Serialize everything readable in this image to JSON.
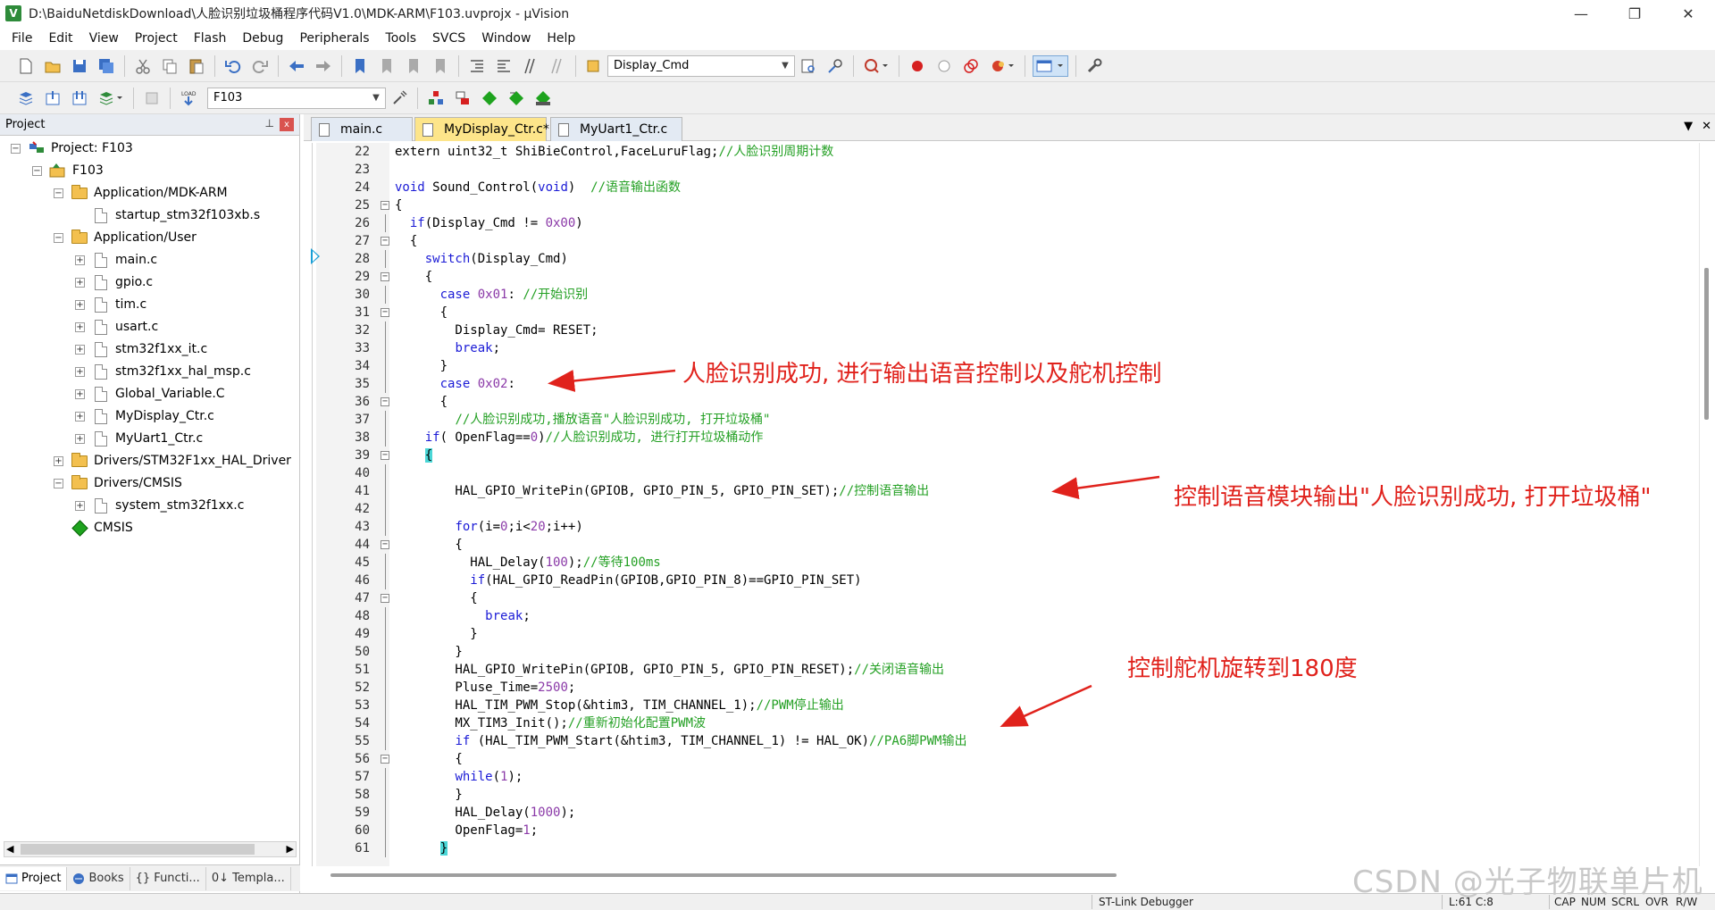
{
  "window": {
    "title": "D:\\BaiduNetdiskDownload\\人脸识别垃圾桶程序代码V1.0\\MDK-ARM\\F103.uvprojx - µVision",
    "logo": "V",
    "minimize": "—",
    "maximize": "❐",
    "close": "✕"
  },
  "menu": [
    "File",
    "Edit",
    "View",
    "Project",
    "Flash",
    "Debug",
    "Peripherals",
    "Tools",
    "SVCS",
    "Window",
    "Help"
  ],
  "toolbar1": {
    "find_combo": "Display_Cmd",
    "icons": [
      "new-file-icon",
      "open-file-icon",
      "save-icon",
      "save-all-icon",
      "cut-icon",
      "copy-icon",
      "paste-icon",
      "undo-icon",
      "redo-icon",
      "back-icon",
      "forward-icon",
      "bookmark-icon",
      "prev-bookmark-icon",
      "next-bookmark-icon",
      "clear-bookmark-icon",
      "indent-icon",
      "unindent-icon",
      "comment-icon",
      "uncomment-icon",
      "find-in-files-icon",
      "find-icon",
      "incremental-find-icon",
      "debug-session-icon",
      "breakpoint-icon",
      "disable-breakpoint-icon",
      "kill-breakpoints-icon",
      "run-to-cursor-icon",
      "window-layout-icon",
      "configure-icon"
    ]
  },
  "toolbar2": {
    "target_combo": "F103",
    "icons": [
      "translate-icon",
      "build-icon",
      "rebuild-icon",
      "batch-build-icon",
      "stop-build-icon",
      "load-icon",
      "target-options-icon",
      "manage-components-icon",
      "component-icon",
      "pack-installer-icon",
      "select-packs-icon"
    ],
    "load_label": "LOAD"
  },
  "project_panel": {
    "title": "Project",
    "pin": "📌",
    "close": "x",
    "tree": [
      {
        "level": 0,
        "expander": "−",
        "icon": "project",
        "label": "Project: F103"
      },
      {
        "level": 1,
        "expander": "−",
        "icon": "target",
        "label": "F103"
      },
      {
        "level": 2,
        "expander": "−",
        "icon": "folder",
        "label": "Application/MDK-ARM"
      },
      {
        "level": 3,
        "expander": "",
        "icon": "file",
        "label": "startup_stm32f103xb.s"
      },
      {
        "level": 2,
        "expander": "−",
        "icon": "folder",
        "label": "Application/User"
      },
      {
        "level": 3,
        "expander": "+",
        "icon": "file",
        "label": "main.c"
      },
      {
        "level": 3,
        "expander": "+",
        "icon": "file",
        "label": "gpio.c"
      },
      {
        "level": 3,
        "expander": "+",
        "icon": "file",
        "label": "tim.c"
      },
      {
        "level": 3,
        "expander": "+",
        "icon": "file",
        "label": "usart.c"
      },
      {
        "level": 3,
        "expander": "+",
        "icon": "file",
        "label": "stm32f1xx_it.c"
      },
      {
        "level": 3,
        "expander": "+",
        "icon": "file",
        "label": "stm32f1xx_hal_msp.c"
      },
      {
        "level": 3,
        "expander": "+",
        "icon": "file",
        "label": "Global_Variable.C"
      },
      {
        "level": 3,
        "expander": "+",
        "icon": "file",
        "label": "MyDisplay_Ctr.c"
      },
      {
        "level": 3,
        "expander": "+",
        "icon": "file",
        "label": "MyUart1_Ctr.c"
      },
      {
        "level": 2,
        "expander": "+",
        "icon": "folder",
        "label": "Drivers/STM32F1xx_HAL_Driver"
      },
      {
        "level": 2,
        "expander": "−",
        "icon": "folder",
        "label": "Drivers/CMSIS"
      },
      {
        "level": 3,
        "expander": "+",
        "icon": "file",
        "label": "system_stm32f1xx.c"
      },
      {
        "level": 2,
        "expander": "",
        "icon": "diamond",
        "label": "CMSIS"
      }
    ],
    "bottom_tabs": [
      {
        "label": "Project",
        "icon": "project-tab-icon"
      },
      {
        "label": "Books",
        "icon": "books-tab-icon"
      },
      {
        "label": "{} Functi...",
        "icon": "functions-tab-icon"
      },
      {
        "label": "0↓ Templa...",
        "icon": "templates-tab-icon"
      }
    ],
    "scroll_left": "◀",
    "scroll_right": "▶"
  },
  "editor": {
    "tabs": [
      {
        "label": "main.c",
        "active": false
      },
      {
        "label": "MyDisplay_Ctr.c*",
        "active": true
      },
      {
        "label": "MyUart1_Ctr.c",
        "active": false
      }
    ],
    "tab_controls": [
      "▼",
      "✕"
    ],
    "lines": [
      {
        "n": "22",
        "fold": "",
        "code": [
          [
            "",
            "extern uint32_t ShiBieControl,FaceLuruFlag;"
          ],
          [
            "cm",
            "//人脸识别周期计数"
          ]
        ]
      },
      {
        "n": "23",
        "fold": "",
        "code": []
      },
      {
        "n": "24",
        "fold": "",
        "code": [
          [
            "kw",
            "void"
          ],
          [
            "",
            " Sound_Control("
          ],
          [
            "kw",
            "void"
          ],
          [
            "",
            ")  "
          ],
          [
            "cm",
            "//语音输出函数"
          ]
        ]
      },
      {
        "n": "25",
        "fold": "box",
        "code": [
          [
            "",
            "{"
          ]
        ]
      },
      {
        "n": "26",
        "fold": "line",
        "code": [
          [
            "",
            "  "
          ],
          [
            "kw",
            "if"
          ],
          [
            "",
            "(Display_Cmd != "
          ],
          [
            "num",
            "0x00"
          ],
          [
            "",
            ")"
          ]
        ]
      },
      {
        "n": "27",
        "fold": "box",
        "code": [
          [
            "",
            "  {"
          ]
        ]
      },
      {
        "n": "28",
        "fold": "line",
        "code": [
          [
            "",
            "    "
          ],
          [
            "kw",
            "switch"
          ],
          [
            "",
            "(Display_Cmd)"
          ]
        ]
      },
      {
        "n": "29",
        "fold": "box",
        "code": [
          [
            "",
            "    {"
          ]
        ]
      },
      {
        "n": "30",
        "fold": "line",
        "code": [
          [
            "",
            "      "
          ],
          [
            "kw",
            "case"
          ],
          [
            "",
            " "
          ],
          [
            "num",
            "0x01"
          ],
          [
            "",
            ": "
          ],
          [
            "cm",
            "//开始识别"
          ]
        ]
      },
      {
        "n": "31",
        "fold": "box",
        "code": [
          [
            "",
            "      {"
          ]
        ]
      },
      {
        "n": "32",
        "fold": "line",
        "code": [
          [
            "",
            "        Display_Cmd= RESET;"
          ]
        ]
      },
      {
        "n": "33",
        "fold": "line",
        "code": [
          [
            "",
            "        "
          ],
          [
            "kw",
            "break"
          ],
          [
            "",
            ";"
          ]
        ]
      },
      {
        "n": "34",
        "fold": "line",
        "code": [
          [
            "",
            "      }"
          ]
        ]
      },
      {
        "n": "35",
        "fold": "line",
        "code": [
          [
            "",
            "      "
          ],
          [
            "kw",
            "case"
          ],
          [
            "",
            " "
          ],
          [
            "num",
            "0x02"
          ],
          [
            "",
            ":"
          ]
        ]
      },
      {
        "n": "36",
        "fold": "box",
        "code": [
          [
            "",
            "      {"
          ]
        ]
      },
      {
        "n": "37",
        "fold": "line",
        "code": [
          [
            "",
            "        "
          ],
          [
            "cm",
            "//人脸识别成功,播放语音\"人脸识别成功, 打开垃圾桶\""
          ]
        ]
      },
      {
        "n": "38",
        "fold": "line",
        "code": [
          [
            "",
            "    "
          ],
          [
            "kw",
            "if"
          ],
          [
            "",
            "( OpenFlag=="
          ],
          [
            "num",
            "0"
          ],
          [
            "",
            ")"
          ],
          [
            "cm",
            "//人脸识别成功, 进行打开垃圾桶动作"
          ]
        ]
      },
      {
        "n": "39",
        "fold": "box",
        "code": [
          [
            "",
            "    "
          ],
          [
            "brk",
            "{"
          ]
        ]
      },
      {
        "n": "40",
        "fold": "line",
        "code": []
      },
      {
        "n": "41",
        "fold": "line",
        "code": [
          [
            "",
            "        HAL_GPIO_WritePin(GPIOB, GPIO_PIN_5, GPIO_PIN_SET);"
          ],
          [
            "cm",
            "//控制语音输出"
          ]
        ]
      },
      {
        "n": "42",
        "fold": "line",
        "code": []
      },
      {
        "n": "43",
        "fold": "line",
        "code": [
          [
            "",
            "        "
          ],
          [
            "kw",
            "for"
          ],
          [
            "",
            "(i="
          ],
          [
            "num",
            "0"
          ],
          [
            "",
            ";i<"
          ],
          [
            "num",
            "20"
          ],
          [
            "",
            ";i++)"
          ]
        ]
      },
      {
        "n": "44",
        "fold": "box",
        "code": [
          [
            "",
            "        {"
          ]
        ]
      },
      {
        "n": "45",
        "fold": "line",
        "code": [
          [
            "",
            "          HAL_Delay("
          ],
          [
            "num",
            "100"
          ],
          [
            "",
            ");"
          ],
          [
            "cm",
            "//等待100ms"
          ]
        ]
      },
      {
        "n": "46",
        "fold": "line",
        "code": [
          [
            "",
            "          "
          ],
          [
            "kw",
            "if"
          ],
          [
            "",
            "(HAL_GPIO_ReadPin(GPIOB,GPIO_PIN_8)==GPIO_PIN_SET)"
          ]
        ]
      },
      {
        "n": "47",
        "fold": "box",
        "code": [
          [
            "",
            "          {"
          ]
        ]
      },
      {
        "n": "48",
        "fold": "line",
        "code": [
          [
            "",
            "            "
          ],
          [
            "kw",
            "break"
          ],
          [
            "",
            ";"
          ]
        ]
      },
      {
        "n": "49",
        "fold": "line",
        "code": [
          [
            "",
            "          }"
          ]
        ]
      },
      {
        "n": "50",
        "fold": "line",
        "code": [
          [
            "",
            "        }"
          ]
        ]
      },
      {
        "n": "51",
        "fold": "line",
        "code": [
          [
            "",
            "        HAL_GPIO_WritePin(GPIOB, GPIO_PIN_5, GPIO_PIN_RESET);"
          ],
          [
            "cm",
            "//关闭语音输出"
          ]
        ]
      },
      {
        "n": "52",
        "fold": "line",
        "code": [
          [
            "",
            "        Pluse_Time="
          ],
          [
            "num",
            "2500"
          ],
          [
            "",
            ";"
          ]
        ]
      },
      {
        "n": "53",
        "fold": "line",
        "code": [
          [
            "",
            "        HAL_TIM_PWM_Stop(&htim3, TIM_CHANNEL_1);"
          ],
          [
            "cm",
            "//PWM停止输出"
          ]
        ]
      },
      {
        "n": "54",
        "fold": "line",
        "code": [
          [
            "",
            "        MX_TIM3_Init();"
          ],
          [
            "cm",
            "//重新初始化配置PWM波"
          ]
        ]
      },
      {
        "n": "55",
        "fold": "line",
        "code": [
          [
            "",
            "        "
          ],
          [
            "kw",
            "if"
          ],
          [
            "",
            " (HAL_TIM_PWM_Start(&htim3, TIM_CHANNEL_1) != HAL_OK)"
          ],
          [
            "cm",
            "//PA6脚PWM输出"
          ]
        ]
      },
      {
        "n": "56",
        "fold": "box",
        "code": [
          [
            "",
            "        {"
          ]
        ]
      },
      {
        "n": "57",
        "fold": "line",
        "code": [
          [
            "",
            "        "
          ],
          [
            "kw",
            "while"
          ],
          [
            "",
            "("
          ],
          [
            "num",
            "1"
          ],
          [
            "",
            ");"
          ]
        ]
      },
      {
        "n": "58",
        "fold": "line",
        "code": [
          [
            "",
            "        }"
          ]
        ]
      },
      {
        "n": "59",
        "fold": "line",
        "code": [
          [
            "",
            "        HAL_Delay("
          ],
          [
            "num",
            "1000"
          ],
          [
            "",
            ");"
          ]
        ]
      },
      {
        "n": "60",
        "fold": "line",
        "code": [
          [
            "",
            "        OpenFlag="
          ],
          [
            "num",
            "1"
          ],
          [
            "",
            ";"
          ]
        ]
      },
      {
        "n": "61",
        "fold": "line",
        "code": [
          [
            "",
            "      "
          ],
          [
            "brk",
            "}"
          ]
        ]
      }
    ],
    "annotations": [
      {
        "text": "人脸识别成功, 进行输出语音控制以及舵机控制"
      },
      {
        "text": "控制语音模块输出\"人脸识别成功, 打开垃圾桶\""
      },
      {
        "text": "控制舵机旋转到180度"
      }
    ],
    "annotation_color": "#e0221c"
  },
  "status": {
    "debugger": "ST-Link Debugger",
    "position": "L:61 C:8",
    "indicators": [
      "CAP",
      "NUM",
      "SCRL",
      "OVR",
      "R/W"
    ]
  },
  "watermark": "CSDN @光子物联单片机",
  "colors": {
    "keyword": "#1b1bd6",
    "comment": "#24a024",
    "number": "#8b3aa8",
    "active_tab": "#fde58a",
    "panel_header": "#e8ecf2"
  }
}
